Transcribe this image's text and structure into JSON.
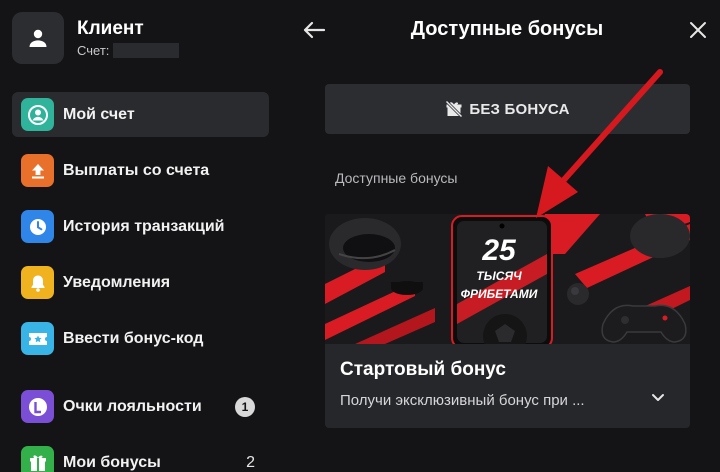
{
  "profile": {
    "name": "Клиент",
    "account_label": "Счет:",
    "avatar_icon": "user-icon"
  },
  "menu": {
    "items": [
      {
        "label": "Мой счет",
        "icon": "account-icon",
        "color": "#2fb39a",
        "active": true
      },
      {
        "label": "Выплаты со счета",
        "icon": "upload-icon",
        "color": "#e8702a",
        "active": false
      },
      {
        "label": "История транзакций",
        "icon": "clock-icon",
        "color": "#2f86e8",
        "active": false
      },
      {
        "label": "Уведомления",
        "icon": "bell-icon",
        "color": "#f0b21e",
        "active": false
      },
      {
        "label": "Ввести бонус-код",
        "icon": "ticket-icon",
        "color": "#39b4e6",
        "active": false
      },
      {
        "label": "Очки лояльности",
        "icon": "loyalty-icon",
        "color": "#7a4fd6",
        "badge": "1",
        "active": false
      },
      {
        "label": "Мои бонусы",
        "icon": "gift-icon",
        "color": "#34b04a",
        "count": "2",
        "active": false
      }
    ]
  },
  "panel": {
    "title": "Доступные бонусы",
    "back_icon": "arrow-left-icon",
    "close_icon": "close-icon"
  },
  "no_bonus": {
    "label": "БЕЗ БОНУСА",
    "icon": "no-gift-icon"
  },
  "section": {
    "label": "Доступные бонусы"
  },
  "bonus_card": {
    "banner": {
      "number": "25",
      "line1": "ТЫСЯЧ",
      "line2": "ФРИБЕТАМИ"
    },
    "title": "Стартовый бонус",
    "description": "Получи эксклюзивный бонус при ...",
    "chevron_icon": "chevron-down-icon"
  },
  "colors": {
    "background": "#141416",
    "surface": "#2c2d31",
    "accent_red": "#d91c24"
  }
}
